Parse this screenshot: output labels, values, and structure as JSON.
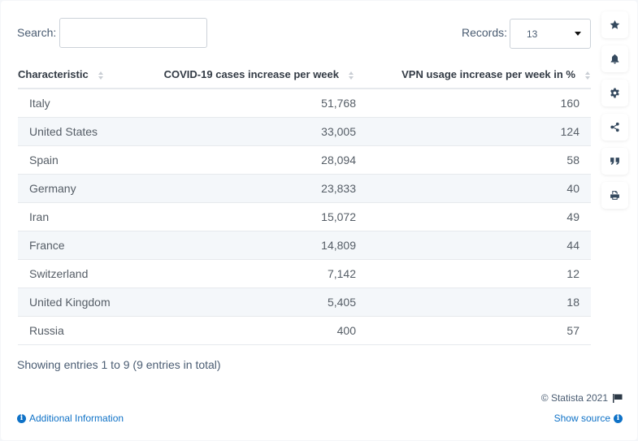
{
  "controls": {
    "search_label": "Search:",
    "search_value": "",
    "search_placeholder": "",
    "records_label": "Records:",
    "records_value": "13"
  },
  "table": {
    "columns": [
      "Characteristic",
      "COVID-19 cases increase per week",
      "VPN usage increase per week in %"
    ],
    "rows": [
      {
        "country": "Italy",
        "covid_cases": "51,768",
        "vpn_increase": "160"
      },
      {
        "country": "United States",
        "covid_cases": "33,005",
        "vpn_increase": "124"
      },
      {
        "country": "Spain",
        "covid_cases": "28,094",
        "vpn_increase": "58"
      },
      {
        "country": "Germany",
        "covid_cases": "23,833",
        "vpn_increase": "40"
      },
      {
        "country": "Iran",
        "covid_cases": "15,072",
        "vpn_increase": "49"
      },
      {
        "country": "France",
        "covid_cases": "14,809",
        "vpn_increase": "44"
      },
      {
        "country": "Switzerland",
        "covid_cases": "7,142",
        "vpn_increase": "12"
      },
      {
        "country": "United Kingdom",
        "covid_cases": "5,405",
        "vpn_increase": "18"
      },
      {
        "country": "Russia",
        "covid_cases": "400",
        "vpn_increase": "57"
      }
    ]
  },
  "footer": {
    "showing_text": "Showing entries 1 to 9 (9 entries in total)",
    "copyright": "© Statista 2021",
    "additional_info": "Additional Information",
    "show_source": "Show source"
  },
  "sidebar": {
    "buttons": [
      {
        "icon": "star-icon",
        "label": "favorite"
      },
      {
        "icon": "bell-icon",
        "label": "notifications"
      },
      {
        "icon": "gear-icon",
        "label": "settings"
      },
      {
        "icon": "share-icon",
        "label": "share"
      },
      {
        "icon": "quote-icon",
        "label": "cite"
      },
      {
        "icon": "print-icon",
        "label": "print"
      }
    ]
  },
  "colors": {
    "link": "#0f72c7",
    "label_text": "#4a5c72",
    "row_stripe": "#f4f7fa",
    "icon": "#34495e"
  }
}
